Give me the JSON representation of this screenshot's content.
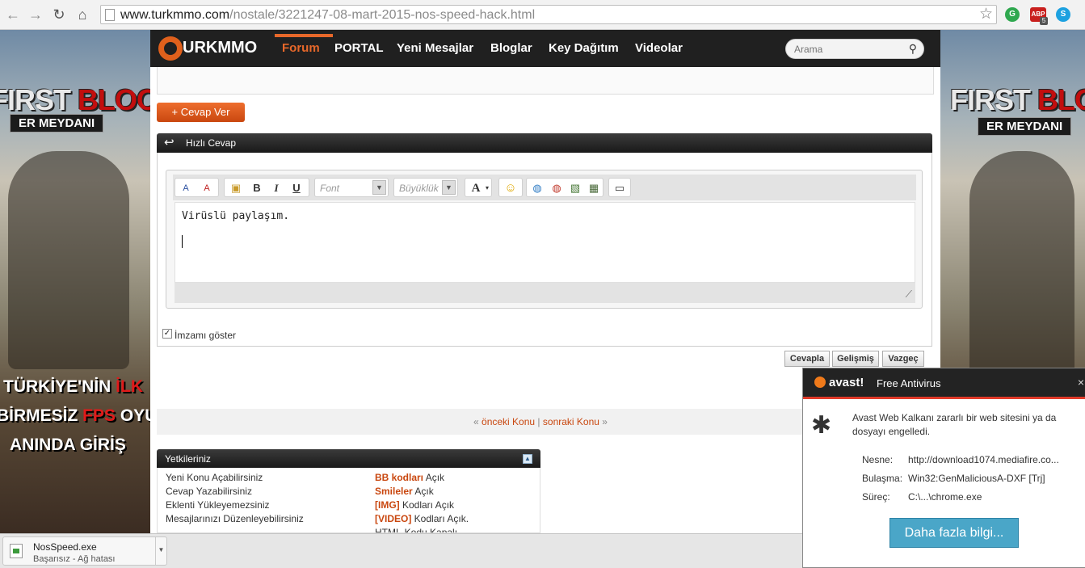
{
  "browser": {
    "url_host": "www.turkmmo.com",
    "url_path": "/nostale/3221247-08-mart-2015-nos-speed-hack.html",
    "ext_abp_label": "ABP",
    "ext_abp_badge": "5"
  },
  "site": {
    "logo_text": "URKMMO",
    "nav": [
      "Forum",
      "PORTAL",
      "Yeni Mesajlar",
      "Bloglar",
      "Key Dağıtım",
      "Videolar"
    ],
    "search_placeholder": "Arama"
  },
  "ads": {
    "left": {
      "title_white": "FIRST ",
      "title_red": "BLOOD",
      "subtitle": "ER MEYDANI",
      "promo": [
        {
          "parts": [
            "TÜRKİYE'NİN ",
            "İLK"
          ]
        },
        {
          "parts": [
            "BİRMESİZ ",
            "FPS",
            " OYUNU"
          ]
        },
        {
          "parts": [
            "ANINDA GİRİŞ"
          ]
        }
      ]
    },
    "right": {
      "title_white": "FIRST ",
      "title_red": "BLOOD",
      "subtitle": "ER MEYDANI"
    }
  },
  "thread": {
    "reply_button": "+ Cevap Ver",
    "quick_reply_title": "Hızlı Cevap",
    "editor": {
      "font_placeholder": "Font",
      "size_placeholder": "Büyüklük",
      "content": "Virüslü paylaşım."
    },
    "signature_label": "İmzamı göster",
    "buttons": {
      "submit": "Cevapla",
      "advanced": "Gelişmiş",
      "cancel": "Vazgeç"
    },
    "nav_links": {
      "open": "«",
      "prev": "önceki Konu",
      "sep": "|",
      "next": "sonraki Konu",
      "close": "»"
    }
  },
  "permissions": {
    "title": "Yetkileriniz",
    "left": [
      "Yeni Konu Açabilirsiniz",
      "Cevap Yazabilirsiniz",
      "Eklenti Yükleyemezsiniz",
      "Mesajlarınızı Düzenleyebilirsiniz"
    ],
    "right": [
      {
        "key": "BB kodları",
        "val": " Açık"
      },
      {
        "key": "Smileler",
        "val": " Açık"
      },
      {
        "key": "[IMG]",
        "val": " Kodları Açık"
      },
      {
        "key": "[VIDEO]",
        "val": " Kodları Açık."
      },
      {
        "key": "",
        "val": "HTML-Kodu Kapalı"
      }
    ]
  },
  "avast": {
    "brand": "avast!",
    "product": "Free Antivirus",
    "close": "×",
    "message": "Avast Web Kalkanı zararlı bir web sitesini ya da dosyayı engelledi.",
    "fields": [
      {
        "k": "Nesne:",
        "v": "http://download1074.mediafire.co..."
      },
      {
        "k": "Bulaşma:",
        "v": "Win32:GenMaliciousA-DXF [Trj]"
      },
      {
        "k": "Süreç:",
        "v": "C:\\...\\chrome.exe"
      }
    ],
    "more_button": "Daha fazla bilgi..."
  },
  "download": {
    "filename": "NosSpeed.exe",
    "status": "Başarısız - Ağ hatası"
  },
  "colors": {
    "accent": "#e8682a",
    "header_bg": "#202020",
    "avast_red": "#e13a2a",
    "avast_button": "#4aa6c8"
  }
}
